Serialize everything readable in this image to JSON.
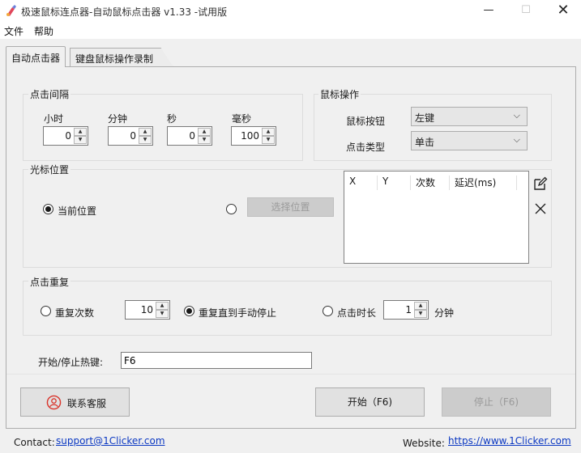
{
  "window": {
    "title": "极速鼠标连点器-自动鼠标点击器 v1.33  -试用版",
    "minimize": "—",
    "maximize": "☐",
    "close": "✕"
  },
  "menu": {
    "file": "文件",
    "help": "帮助"
  },
  "tabs": {
    "auto_clicker": "自动点击器",
    "record": "键盘鼠标操作录制"
  },
  "interval": {
    "group_label": "点击间隔",
    "hours_label": "小时",
    "hours": "0",
    "minutes_label": "分钟",
    "minutes": "0",
    "seconds_label": "秒",
    "seconds": "0",
    "ms_label": "毫秒",
    "ms": "100"
  },
  "mouse": {
    "group_label": "鼠标操作",
    "button_label": "鼠标按钮",
    "button_value": "左键",
    "click_type_label": "点击类型",
    "click_type_value": "单击"
  },
  "cursor": {
    "group_label": "光标位置",
    "current_label": "当前位置",
    "select_button": "选择位置",
    "table_headers": [
      "X",
      "Y",
      "次数",
      "延迟(ms)"
    ]
  },
  "repeat": {
    "group_label": "点击重复",
    "times_label": "重复次数",
    "times_value": "10",
    "until_stop_label": "重复直到手动停止",
    "duration_label": "点击时长",
    "duration_value": "1",
    "duration_unit": "分钟"
  },
  "hotkey": {
    "label": "开始/停止热键:",
    "value": "F6"
  },
  "buttons": {
    "contact": "联系客服",
    "start": "开始（F6)",
    "stop": "停止（F6)"
  },
  "footer": {
    "contact_label": "Contact:",
    "contact_email": "support@1Clicker.com",
    "website_label": "Website:",
    "website_url": "https://www.1Clicker.com"
  },
  "colors": {
    "link": "#0b38c2",
    "contact_icon": "#d9342b",
    "radio_selected": "#1a1a1a"
  }
}
